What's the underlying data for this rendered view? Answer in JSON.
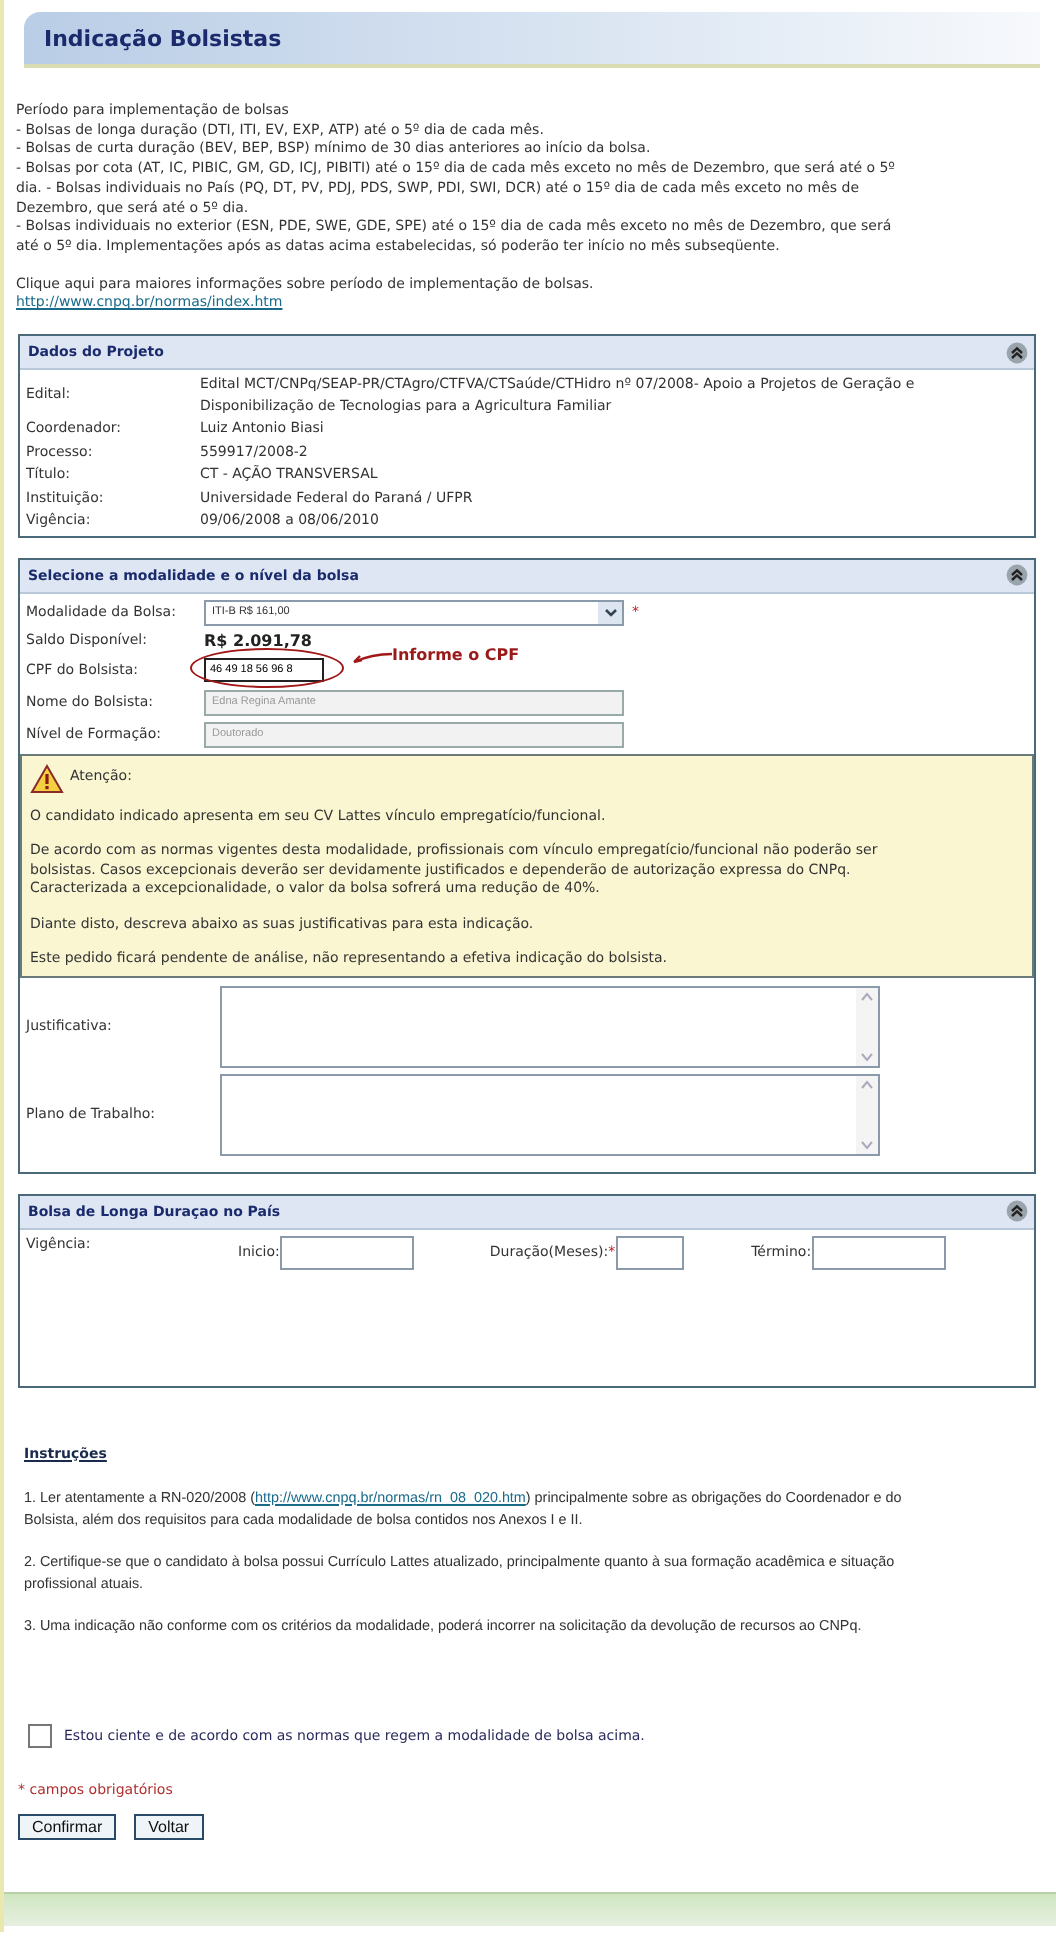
{
  "page_title": "Indicação Bolsistas",
  "intro": {
    "heading": "Período para implementação de bolsas",
    "items": [
      "- Bolsas de longa duração (DTI, ITI, EV, EXP, ATP) até o 5º dia de cada mês.",
      "- Bolsas de curta duração (BEV, BEP, BSP) mínimo de 30 dias anteriores ao início da bolsa.",
      "- Bolsas por cota (AT, IC, PIBIC, GM, GD, ICJ, PIBITI) até o 15º dia de cada mês exceto no mês de Dezembro, que será até o 5º dia. - Bolsas individuais no País (PQ, DT, PV, PDJ, PDS, SWP, PDI, SWI, DCR) até o 15º dia de cada mês exceto no mês de Dezembro, que será até o 5º dia.",
      "- Bolsas individuais no exterior (ESN, PDE, SWE, GDE, SPE) até o 15º dia de cada mês exceto no mês de Dezembro, que será até o 5º dia. Implementações após as datas acima estabelecidas, só poderão ter início no mês subseqüente."
    ],
    "more_text": "Clique aqui para maiores informações sobre período de implementação de bolsas.",
    "more_link": "http://www.cnpq.br/normas/index.htm"
  },
  "project": {
    "title": "Dados do Projeto",
    "expanded": true,
    "rows": [
      {
        "label": "Edital:",
        "value": "Edital MCT/CNPq/SEAP-PR/CTAgro/CTFVA/CTSaúde/CTHidro nº 07/2008- Apoio a Projetos de Geração e Disponibilização de Tecnologias para a Agricultura Familiar"
      },
      {
        "label": "Coordenador:",
        "value": "Luiz Antonio Biasi"
      },
      {
        "label": "Processo:",
        "value": "559917/2008-2"
      },
      {
        "label": "Título:",
        "value": "CT - AÇÃO TRANSVERSAL"
      },
      {
        "label": "Instituição:",
        "value": "Universidade Federal do Paraná / UFPR"
      },
      {
        "label": "Vigência:",
        "value": "09/06/2008 a 08/06/2010"
      }
    ]
  },
  "modality": {
    "title": "Selecione a modalidade e o nível da bolsa",
    "expanded": true,
    "fields": [
      {
        "kind": "select",
        "label": "Modalidade da Bolsa:",
        "value": "ITI-B R$ 161,00",
        "required_mark": "*"
      },
      {
        "kind": "amount",
        "label": "Saldo Disponível:",
        "value": "R$ 2.091,78"
      },
      {
        "kind": "cpf",
        "label": "CPF do Bolsista:",
        "value": "46 49 18 56 96 8",
        "annotation": "Informe o CPF"
      },
      {
        "kind": "readonly",
        "label": "Nome do Bolsista:",
        "value": "Edna Regina Amante"
      },
      {
        "kind": "readonly",
        "label": "Nível de Formação:",
        "value": "Doutorado"
      }
    ],
    "warning": {
      "title": "Atenção:",
      "paragraphs": [
        "O candidato indicado apresenta em seu CV Lattes vínculo empregatício/funcional.",
        "De acordo com as normas vigentes desta modalidade, profissionais com vínculo empregatício/funcional não poderão ser bolsistas. Casos excepcionais deverão ser devidamente justificados e dependerão de autorização expressa do CNPq. Caracterizada a excepcionalidade, o valor da bolsa sofrerá uma redução de 40%.",
        "Diante disto, descreva abaixo as suas justificativas para esta indicação.",
        "Este pedido ficará pendente de análise, não representando a efetiva indicação do bolsista."
      ]
    },
    "textareas": [
      {
        "label": "Justificativa:"
      },
      {
        "label": "Plano de Trabalho:"
      }
    ]
  },
  "long_term": {
    "title": "Bolsa de Longa Duraçao no País",
    "expanded": true,
    "label": "Vigência:",
    "fields": [
      {
        "label": "Inicio:"
      },
      {
        "label": "Duração(Meses):",
        "required_mark": "*"
      },
      {
        "label": "Término:"
      }
    ]
  },
  "instructions": {
    "title": "Instruções",
    "items": [
      {
        "before": "1. Ler atentamente a RN-020/2008 (",
        "link": "http://www.cnpq.br/normas/rn_08_020.htm",
        "after": ") principalmente sobre as obrigações do Coordenador e do Bolsista, além dos requisitos para cada modalidade de bolsa contidos nos Anexos I e II."
      },
      {
        "before": "2. Certifique-se que o candidato à bolsa possui Currículo Lattes atualizado, principalmente quanto à sua formação acadêmica e situação profissional atuais."
      },
      {
        "before": "3. Uma indicação não conforme com os critérios da modalidade, poderá incorrer na solicitação da devolução de recursos ao CNPq."
      }
    ]
  },
  "agreement": {
    "label": "Estou ciente e de acordo com as normas que regem a modalidade de bolsa acima.",
    "checked": false
  },
  "required_note": {
    "mark": "*",
    "text": "campos obrigatórios"
  },
  "buttons": [
    "Confirmar",
    "Voltar"
  ]
}
